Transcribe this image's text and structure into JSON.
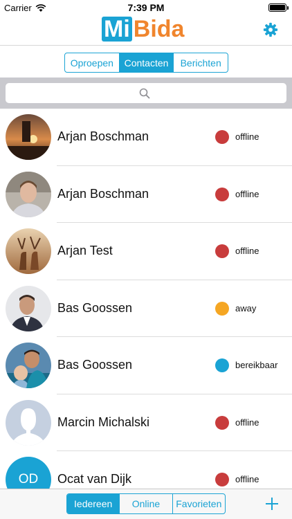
{
  "statusbar": {
    "carrier": "Carrier",
    "time": "7:39 PM"
  },
  "header": {
    "logo_mi": "Mi",
    "logo_bida": "Bida"
  },
  "tabs_top": [
    {
      "label": "Oproepen",
      "active": false
    },
    {
      "label": "Contacten",
      "active": true
    },
    {
      "label": "Berichten",
      "active": false
    }
  ],
  "search": {
    "placeholder": ""
  },
  "contacts": [
    {
      "name": "Arjan Boschman",
      "status": "offline",
      "status_color": "#c83c3c",
      "avatar": "photo"
    },
    {
      "name": "Arjan Boschman",
      "status": "offline",
      "status_color": "#c83c3c",
      "avatar": "photo"
    },
    {
      "name": "Arjan Test",
      "status": "offline",
      "status_color": "#c83c3c",
      "avatar": "photo"
    },
    {
      "name": "Bas Goossen",
      "status": "away",
      "status_color": "#f5a623",
      "avatar": "photo"
    },
    {
      "name": "Bas Goossen",
      "status": "bereikbaar",
      "status_color": "#1aa3d4",
      "avatar": "photo"
    },
    {
      "name": "Marcin Michalski",
      "status": "offline",
      "status_color": "#c83c3c",
      "avatar": "silhouette"
    },
    {
      "name": "Ocat van Dijk",
      "status": "offline",
      "status_color": "#c83c3c",
      "avatar": "initials",
      "initials": "OD"
    }
  ],
  "tabs_bottom": [
    {
      "label": "Iedereen",
      "active": true
    },
    {
      "label": "Online",
      "active": false
    },
    {
      "label": "Favorieten",
      "active": false
    }
  ],
  "colors": {
    "accent": "#1aa3d4",
    "brand_orange": "#f0852d",
    "offline": "#c83c3c",
    "away": "#f5a623",
    "available": "#1aa3d4"
  },
  "icons": {
    "settings": "gear-icon",
    "search": "search-icon",
    "add": "plus-icon",
    "wifi": "wifi-icon",
    "battery": "battery-icon"
  }
}
